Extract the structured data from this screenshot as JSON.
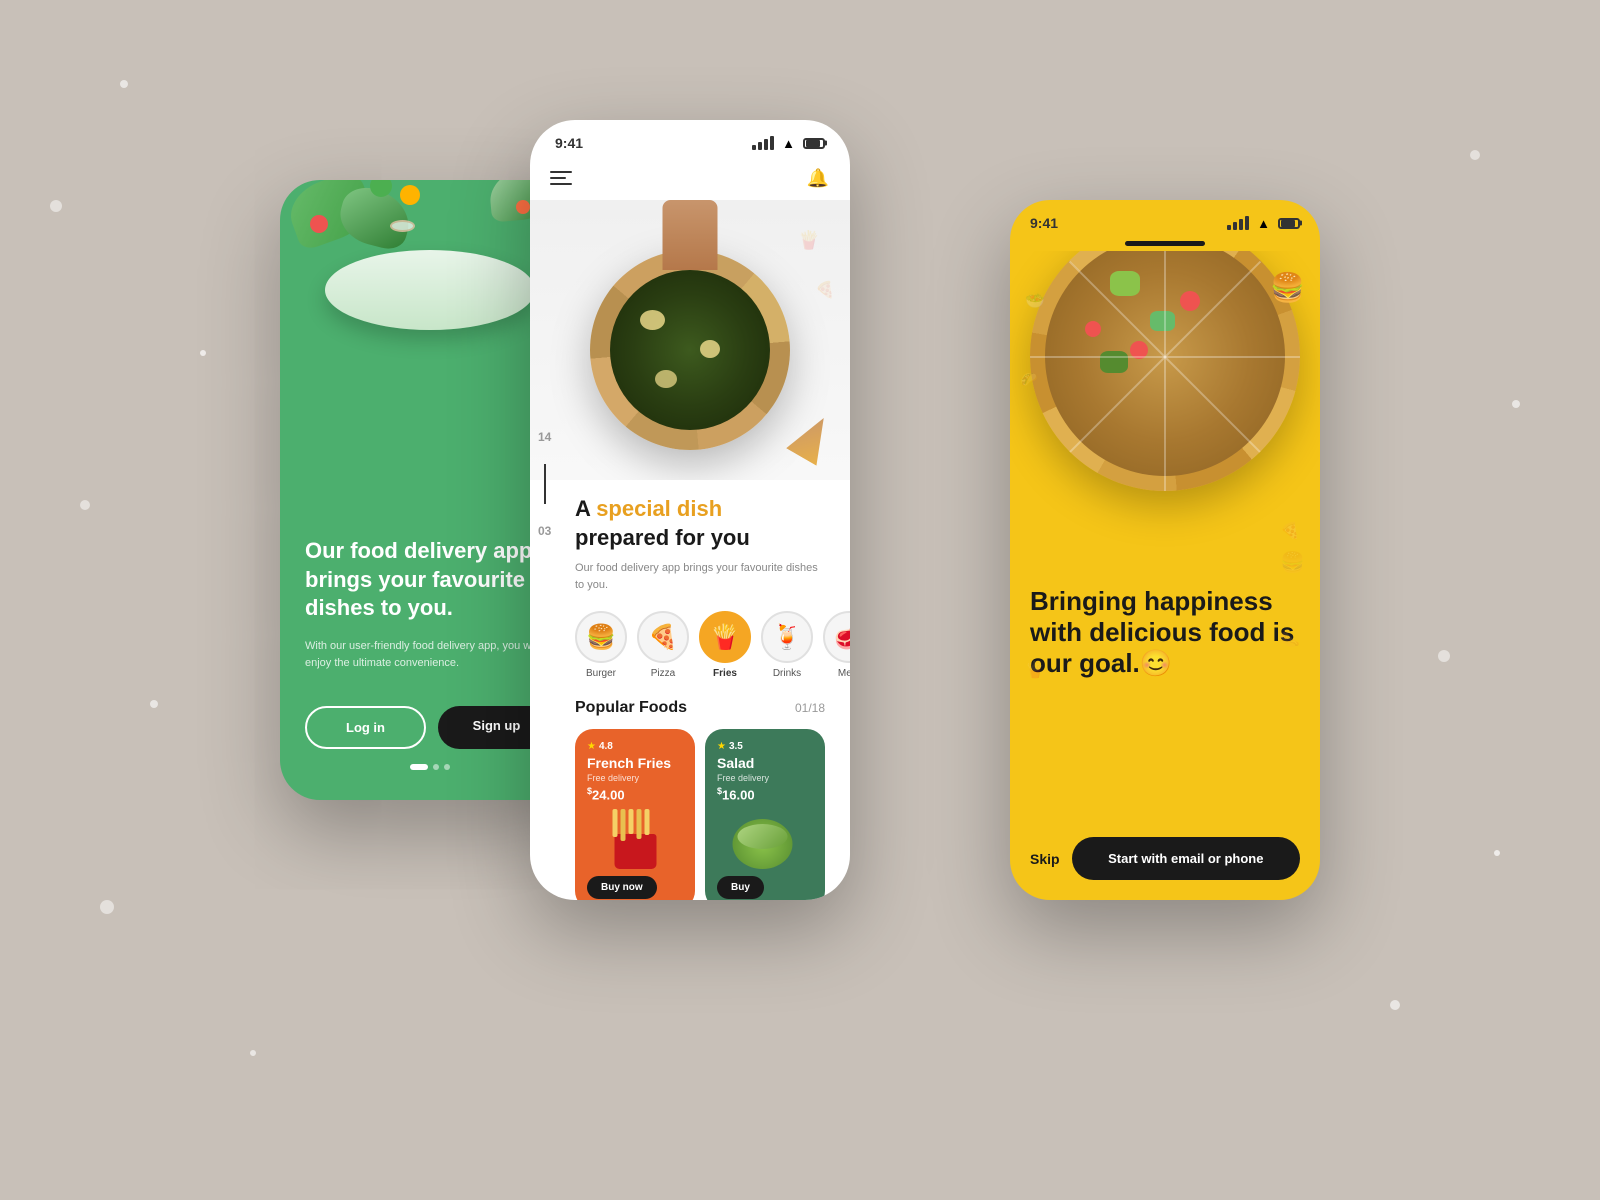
{
  "app": {
    "background_color": "#c8c0b8"
  },
  "phone_left": {
    "headline": "Our food delivery app brings your favourite dishes to you.",
    "subtext": "With our user-friendly food delivery app, you will enjoy the ultimate convenience.",
    "btn_login": "Log in",
    "btn_signup": "Sign up"
  },
  "phone_middle": {
    "time": "9:41",
    "title_prefix": "A ",
    "title_highlight": "special dish",
    "title_suffix": " prepared for you",
    "description": "Our food delivery app brings your favourite dishes to you.",
    "categories": [
      {
        "label": "Burger",
        "emoji": "🍔",
        "active": false
      },
      {
        "label": "Pizza",
        "emoji": "🍕",
        "active": false
      },
      {
        "label": "Fries",
        "emoji": "🍟",
        "active": true
      },
      {
        "label": "Drinks",
        "emoji": "🍹",
        "active": false
      },
      {
        "label": "Meat",
        "emoji": "🥩",
        "active": false
      }
    ],
    "popular_foods_title": "Popular Foods",
    "popular_foods_count": "01/18",
    "nav_top": "14",
    "nav_bottom": "03",
    "foods": [
      {
        "rating": "4.8",
        "name": "French Fries",
        "delivery": "Free delivery",
        "price": "$24.00",
        "btn": "Buy now",
        "bg_color": "#e8632a"
      },
      {
        "rating": "3.5",
        "name": "Salad",
        "delivery": "Free delivery",
        "price": "$16.00",
        "btn": "Buy",
        "bg_color": "#3d7a5a"
      }
    ]
  },
  "phone_right": {
    "time": "9:41",
    "headline": "Bringing happiness with delicious food is our goal.",
    "emoji": "😊",
    "btn_skip": "Skip",
    "btn_start": "Start with email or phone"
  }
}
